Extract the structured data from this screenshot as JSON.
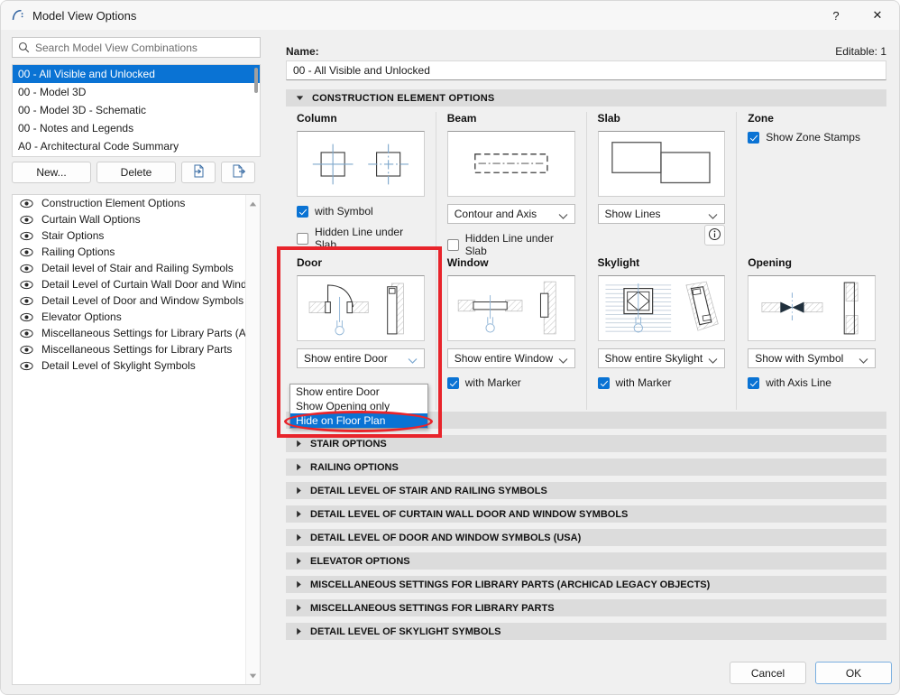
{
  "window": {
    "title": "Model View Options",
    "app_icon": "archicad-arc-icon",
    "help_label": "?",
    "close_label": "✕"
  },
  "sidebar": {
    "search": {
      "placeholder": "Search Model View Combinations",
      "value": "",
      "icon": "search-icon"
    },
    "combinations": [
      {
        "label": "00 - All Visible and Unlocked",
        "selected": true
      },
      {
        "label": "00 - Model 3D",
        "selected": false
      },
      {
        "label": "00 - Model 3D - Schematic",
        "selected": false
      },
      {
        "label": "00 - Notes and Legends",
        "selected": false
      },
      {
        "label": "A0 - Architectural Code Summary",
        "selected": false
      }
    ],
    "buttons": {
      "new_label": "New...",
      "delete_label": "Delete",
      "import_icon": "import-icon",
      "export_icon": "export-icon"
    },
    "options_list": [
      {
        "label": "Construction Element Options",
        "icon": "eye-icon"
      },
      {
        "label": "Curtain Wall Options",
        "icon": "eye-icon"
      },
      {
        "label": "Stair Options",
        "icon": "eye-icon"
      },
      {
        "label": "Railing Options",
        "icon": "eye-icon"
      },
      {
        "label": "Detail level of Stair and Railing Symbols",
        "icon": "eye-icon"
      },
      {
        "label": "Detail Level of Curtain Wall Door and Windo...",
        "icon": "eye-icon"
      },
      {
        "label": "Detail Level of Door and Window Symbols (USA)",
        "icon": "eye-icon"
      },
      {
        "label": "Elevator Options",
        "icon": "eye-icon"
      },
      {
        "label": "Miscellaneous Settings for Library Parts (Archi...",
        "icon": "eye-icon"
      },
      {
        "label": "Miscellaneous Settings for Library Parts",
        "icon": "eye-icon"
      },
      {
        "label": "Detail Level of Skylight Symbols",
        "icon": "eye-icon"
      }
    ]
  },
  "main": {
    "name_label": "Name:",
    "editable_label": "Editable: 1",
    "name_value": "00 - All Visible and Unlocked",
    "expanded_section": {
      "title": "CONSTRUCTION ELEMENT OPTIONS",
      "expanded": true
    },
    "row1": [
      {
        "title": "Column",
        "preview": "column-symbol-preview",
        "checkboxes": [
          {
            "label": "with Symbol",
            "checked": true
          },
          {
            "label": "Hidden Line under Slab",
            "checked": false
          }
        ]
      },
      {
        "title": "Beam",
        "preview": "beam-symbol-preview",
        "select_value": "Contour and Axis",
        "checkboxes": [
          {
            "label": "Hidden Line under Slab",
            "checked": false
          }
        ]
      },
      {
        "title": "Slab",
        "preview": "slab-symbol-preview",
        "select_value": "Show Lines",
        "info_icon": "info-icon"
      },
      {
        "title": "Zone",
        "checkboxes": [
          {
            "label": "Show Zone Stamps",
            "checked": true
          }
        ]
      }
    ],
    "row2": [
      {
        "title": "Door",
        "preview": "door-symbol-preview",
        "select_value": "Show entire Door",
        "dropdown_open": true,
        "dropdown_options": [
          {
            "label": "Show entire Door",
            "highlighted": false
          },
          {
            "label": "Show Opening only",
            "highlighted": false
          },
          {
            "label": "Hide on Floor Plan",
            "highlighted": true
          }
        ]
      },
      {
        "title": "Window",
        "preview": "window-symbol-preview",
        "select_value": "Show entire Window",
        "checkboxes": [
          {
            "label": "with Marker",
            "checked": true
          }
        ]
      },
      {
        "title": "Skylight",
        "preview": "skylight-symbol-preview",
        "select_value": "Show entire Skylight",
        "checkboxes": [
          {
            "label": "with Marker",
            "checked": true
          }
        ]
      },
      {
        "title": "Opening",
        "preview": "opening-symbol-preview",
        "select_value": "Show with Symbol",
        "checkboxes": [
          {
            "label": "with Axis Line",
            "checked": true
          }
        ]
      }
    ],
    "collapsed_sections": [
      {
        "title": "STAIR OPTIONS"
      },
      {
        "title": "RAILING OPTIONS"
      },
      {
        "title": "DETAIL LEVEL OF STAIR AND RAILING SYMBOLS"
      },
      {
        "title": "DETAIL LEVEL OF CURTAIN WALL DOOR AND WINDOW SYMBOLS"
      },
      {
        "title": "DETAIL LEVEL OF DOOR AND WINDOW SYMBOLS (USA)"
      },
      {
        "title": "ELEVATOR OPTIONS"
      },
      {
        "title": "MISCELLANEOUS SETTINGS FOR LIBRARY PARTS (ARCHICAD LEGACY OBJECTS)"
      },
      {
        "title": "MISCELLANEOUS SETTINGS FOR LIBRARY PARTS"
      },
      {
        "title": "DETAIL LEVEL OF SKYLIGHT SYMBOLS"
      }
    ]
  },
  "footer": {
    "cancel_label": "Cancel",
    "ok_label": "OK"
  },
  "annotations": {
    "highlight_color": "#e8242b",
    "rect_target": "door-group",
    "ellipse_target": "hide-on-floor-plan-option"
  },
  "colors": {
    "accent": "#0a73d4",
    "section_header_bg": "#dcdcdc",
    "dialog_bg": "#f0f0f0"
  }
}
